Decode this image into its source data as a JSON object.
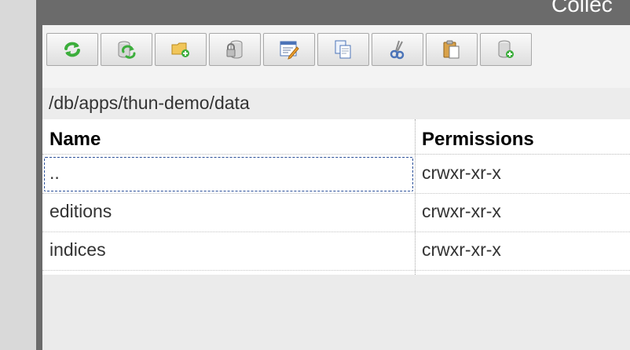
{
  "window": {
    "title": "Collec"
  },
  "toolbar": {
    "buttons": [
      {
        "name": "refresh",
        "icon": "refresh-arrows-icon"
      },
      {
        "name": "refresh-db",
        "icon": "database-refresh-icon"
      },
      {
        "name": "new-collection",
        "icon": "folder-add-icon"
      },
      {
        "name": "permissions",
        "icon": "lock-db-icon"
      },
      {
        "name": "properties",
        "icon": "edit-properties-icon"
      },
      {
        "name": "copy",
        "icon": "copy-icon"
      },
      {
        "name": "cut",
        "icon": "scissors-icon"
      },
      {
        "name": "paste",
        "icon": "paste-clipboard-icon"
      },
      {
        "name": "upload",
        "icon": "database-add-icon"
      }
    ]
  },
  "path": "/db/apps/thun-demo/data",
  "table": {
    "columns": [
      "Name",
      "Permissions"
    ],
    "rows": [
      {
        "name": "..",
        "permissions": "crwxr-xr-x"
      },
      {
        "name": "editions",
        "permissions": "crwxr-xr-x"
      },
      {
        "name": "indices",
        "permissions": "crwxr-xr-x"
      }
    ]
  },
  "colors": {
    "frame": "#6b6b6b",
    "panel": "#ebebeb",
    "focus": "#2a4f99",
    "green_icon": "#3cae3c"
  }
}
